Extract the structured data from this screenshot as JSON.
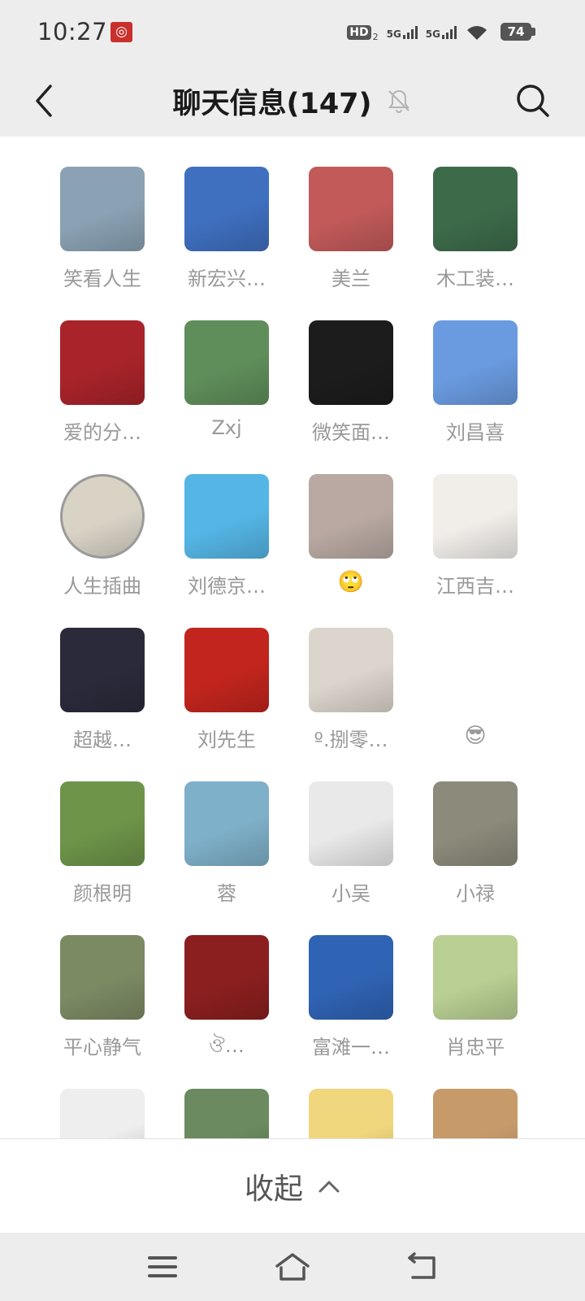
{
  "status_bar": {
    "time": "10:27",
    "hd_label": "HD",
    "hd_sub": "2",
    "sim1_label": "5G",
    "sim1_sub": "1",
    "sim2_label": "5G",
    "battery": "74"
  },
  "header": {
    "title": "聊天信息(147)",
    "back_icon": "chevron-left-icon",
    "mute_icon": "bell-off-icon",
    "search_icon": "search-icon"
  },
  "members": [
    {
      "name": "笑看人生",
      "color": "#8aa2b3"
    },
    {
      "name": "新宏兴…",
      "color": "#3f6fbf"
    },
    {
      "name": "美兰",
      "color": "#c25a5a"
    },
    {
      "name": "木工装…",
      "color": "#3d6b4a"
    },
    {
      "name": "爱的分…",
      "color": "#a8232a"
    },
    {
      "name": "Zxj",
      "color": "#5f8e5a"
    },
    {
      "name": "微笑面…",
      "color": "#1c1c1c"
    },
    {
      "name": "刘昌喜",
      "color": "#6a9be0"
    },
    {
      "name": "人生插曲",
      "color": "#d9d3c6"
    },
    {
      "name": "刘德京…",
      "color": "#55b6e6"
    },
    {
      "name": "🙄",
      "color": "#b9a9a2"
    },
    {
      "name": "江西吉…",
      "color": "#f1eeea"
    },
    {
      "name": "超越…",
      "color": "#2a2a3a"
    },
    {
      "name": "刘先生",
      "color": "#c2251d"
    },
    {
      "name": "º.捌零…",
      "color": "#dcd5cd"
    },
    {
      "name": "😎",
      "color": ""
    },
    {
      "name": "颜根明",
      "color": "#6d9449"
    },
    {
      "name": "蓉",
      "color": "#7fb0c9"
    },
    {
      "name": "小吴",
      "color": "#e9e9e9"
    },
    {
      "name": "小禄",
      "color": "#8c8a7a"
    },
    {
      "name": "平心静气",
      "color": "#7c8a64"
    },
    {
      "name": "ঔ…",
      "color": "#8b1f1f"
    },
    {
      "name": "富滩一…",
      "color": "#2f63b4"
    },
    {
      "name": "肖忠平",
      "color": "#b9cf93"
    },
    {
      "name": "",
      "color": "#eeeeee"
    },
    {
      "name": "",
      "color": "#6b8a5f"
    },
    {
      "name": "",
      "color": "#f0d77e"
    },
    {
      "name": "",
      "color": "#c79a6a"
    }
  ],
  "collapse": {
    "label": "收起",
    "icon": "chevron-up-icon"
  },
  "system_nav": {
    "menu_icon": "menu-icon",
    "home_icon": "home-icon",
    "back_icon": "back-arrow-icon"
  }
}
